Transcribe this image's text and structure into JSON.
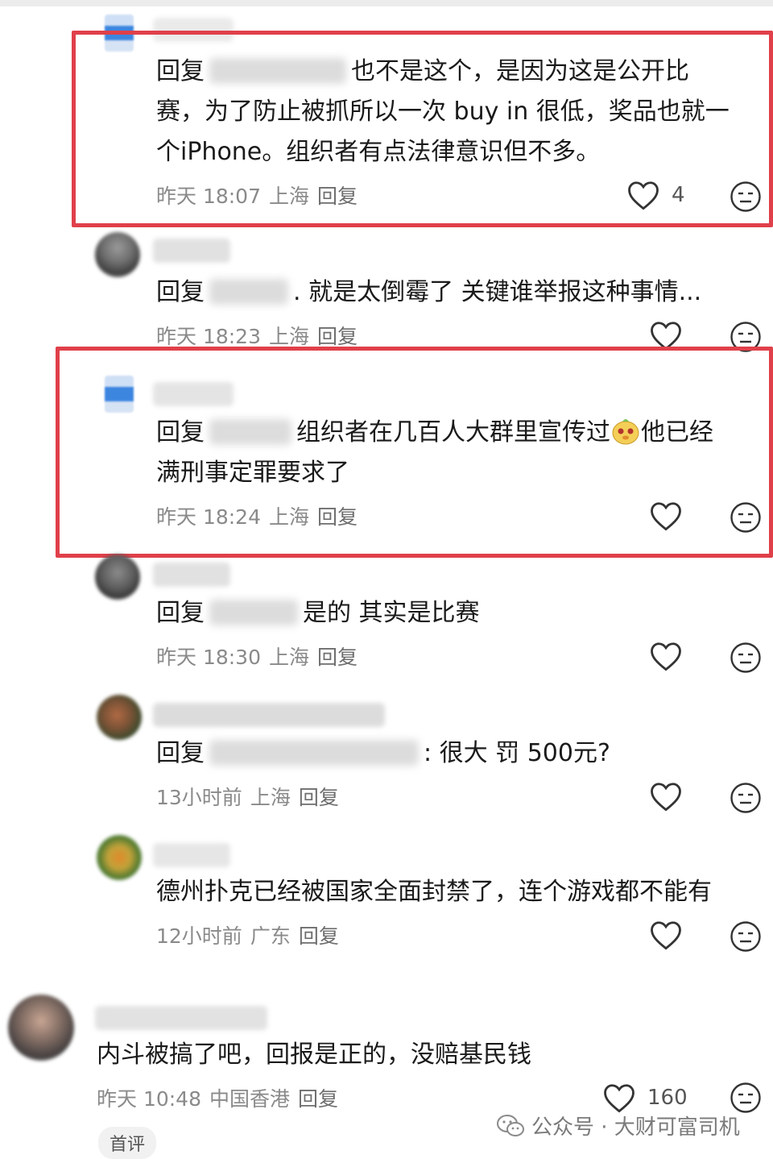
{
  "comments": [
    {
      "reply_prefix": "回复",
      "text_lines": [
        "也不是这个，是因为这是公开比",
        "赛，为了防止被抓所以一次 buy in 很低，奖品也就一",
        "个iPhone。组织者有点法律意识但不多。"
      ],
      "time": "昨天 18:07",
      "location": "上海",
      "reply_label": "回复",
      "likes": "4"
    },
    {
      "reply_prefix": "回复",
      "text_lines": [
        ". 就是太倒霉了 关键谁举报这种事情..."
      ],
      "time": "昨天 18:23",
      "location": "上海",
      "reply_label": "回复",
      "likes": ""
    },
    {
      "reply_prefix": "回复",
      "text_lines": [
        "组织者在几百人大群里宣传过",
        "他已经",
        "满刑事定罪要求了"
      ],
      "time": "昨天 18:24",
      "location": "上海",
      "reply_label": "回复",
      "likes": ""
    },
    {
      "reply_prefix": "回复",
      "text_lines": [
        "是的 其实是比赛"
      ],
      "time": "昨天 18:30",
      "location": "上海",
      "reply_label": "回复",
      "likes": ""
    },
    {
      "reply_prefix": "回复",
      "text_lines": [
        ": 很大 罚 500元?"
      ],
      "time": "13小时前",
      "location": "上海",
      "reply_label": "回复",
      "likes": ""
    },
    {
      "reply_prefix": "",
      "text_lines": [
        "德州扑克已经被国家全面封禁了，连个游戏都不能有"
      ],
      "time": "12小时前",
      "location": "广东",
      "reply_label": "回复",
      "likes": ""
    },
    {
      "reply_prefix": "",
      "text_lines": [
        "内斗被搞了吧，回报是正的，没赔基民钱"
      ],
      "time": "昨天 10:48",
      "location": "中国香港",
      "reply_label": "回复",
      "likes": "160",
      "tag": "首评"
    }
  ],
  "watermark": {
    "text": "公众号 · 大财可富司机",
    "icon": "wechat-icon"
  },
  "colors": {
    "highlight_box": "#e0404a",
    "meta": "#8a8a8a"
  }
}
